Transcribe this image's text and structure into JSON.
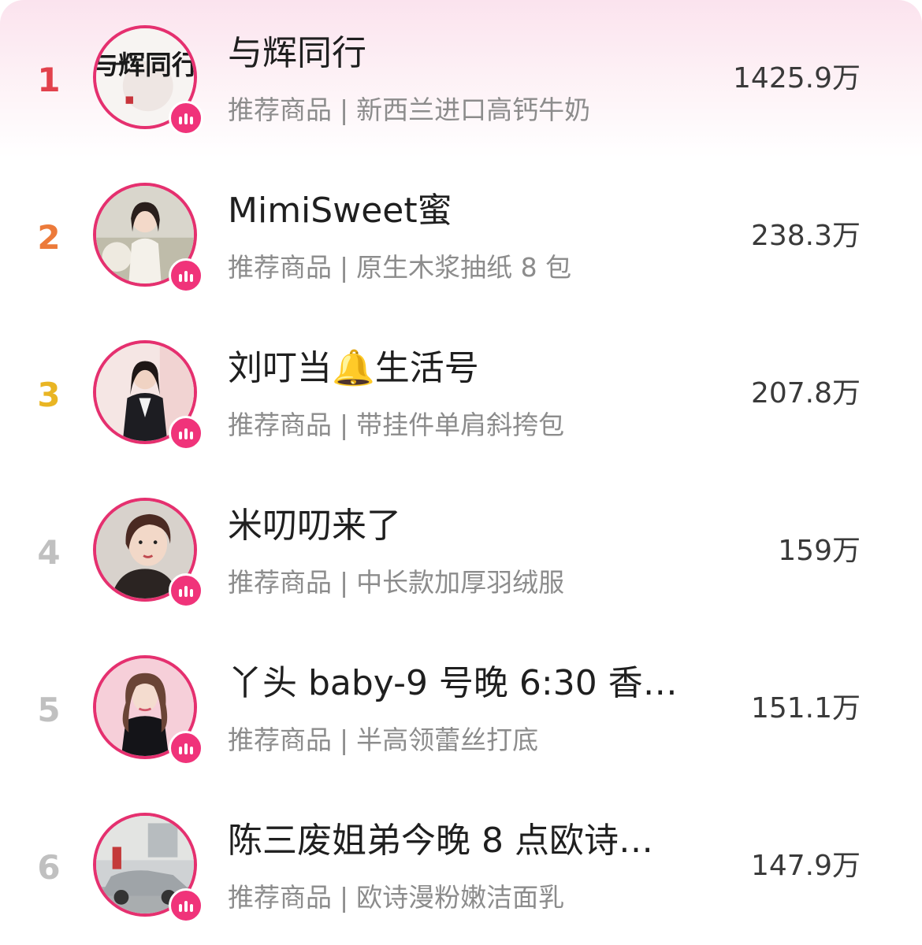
{
  "colors": {
    "accent_pink": "#e5306f",
    "live_badge": "#f0337a",
    "rank1": "#e2414c",
    "rank2": "#ec7a3a",
    "rank3": "#e9b523",
    "rank_other": "#c0c0c0"
  },
  "list": {
    "items": [
      {
        "rank": "1",
        "name": "与辉同行",
        "label": "推荐商品",
        "separator": "|",
        "product": "新西兰进口高钙牛奶",
        "value": "1425.9万",
        "avatar_icon": "calligraphy-logo-avatar",
        "avatar_text": "与辉同行"
      },
      {
        "rank": "2",
        "name": "MimiSweet蜜",
        "label": "推荐商品",
        "separator": "|",
        "product": "原生木浆抽纸 8 包",
        "value": "238.3万",
        "avatar_icon": "woman-qipao-avatar"
      },
      {
        "rank": "3",
        "name": "刘叮当🔔生活号",
        "label": "推荐商品",
        "separator": "|",
        "product": "带挂件单肩斜挎包",
        "value": "207.8万",
        "avatar_icon": "woman-blazer-avatar"
      },
      {
        "rank": "4",
        "name": "米叨叨来了",
        "label": "推荐商品",
        "separator": "|",
        "product": "中长款加厚羽绒服",
        "value": "159万",
        "avatar_icon": "woman-selfie-avatar"
      },
      {
        "rank": "5",
        "name": "丫头 baby-9 号晚 6:30 香…",
        "label": "推荐商品",
        "separator": "|",
        "product": "半高领蕾丝打底",
        "value": "151.1万",
        "avatar_icon": "woman-pink-background-avatar"
      },
      {
        "rank": "6",
        "name": "陈三废姐弟今晚 8 点欧诗…",
        "label": "推荐商品",
        "separator": "|",
        "product": "欧诗漫粉嫩洁面乳",
        "value": "147.9万",
        "avatar_icon": "car-street-avatar"
      }
    ]
  }
}
